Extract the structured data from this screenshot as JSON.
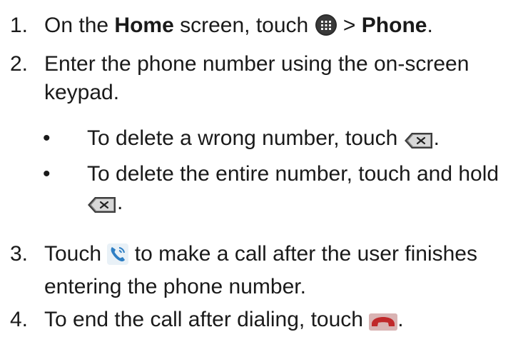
{
  "steps": [
    {
      "number": "1.",
      "before": "On the",
      "bold1": "Home",
      "mid": "screen, touch",
      "sep": ">",
      "bold2": "Phone",
      "end": ".",
      "icon": "apps-grid-icon"
    },
    {
      "number": "2.",
      "line1": "Enter the phone number using the on-screen",
      "line2": "keypad."
    },
    {
      "number": "3.",
      "before": "Touch",
      "after": "to make a call after the user finishes",
      "line2": "entering the phone number.",
      "icon": "phone-call-icon"
    },
    {
      "number": "4.",
      "text": "To end the call after dialing, touch",
      "end": ".",
      "icon": "end-call-icon"
    }
  ],
  "bullets": [
    {
      "symbol": "•",
      "text": "To delete a wrong number, touch",
      "end": ".",
      "icon": "backspace-icon"
    },
    {
      "symbol": "•",
      "text": "To delete the entire number, touch and hold",
      "end": ".",
      "icon": "backspace-icon"
    }
  ],
  "colors": {
    "text": "#1a1a1a",
    "call_green": "#2f7fc4",
    "end_red": "#c0282a"
  }
}
